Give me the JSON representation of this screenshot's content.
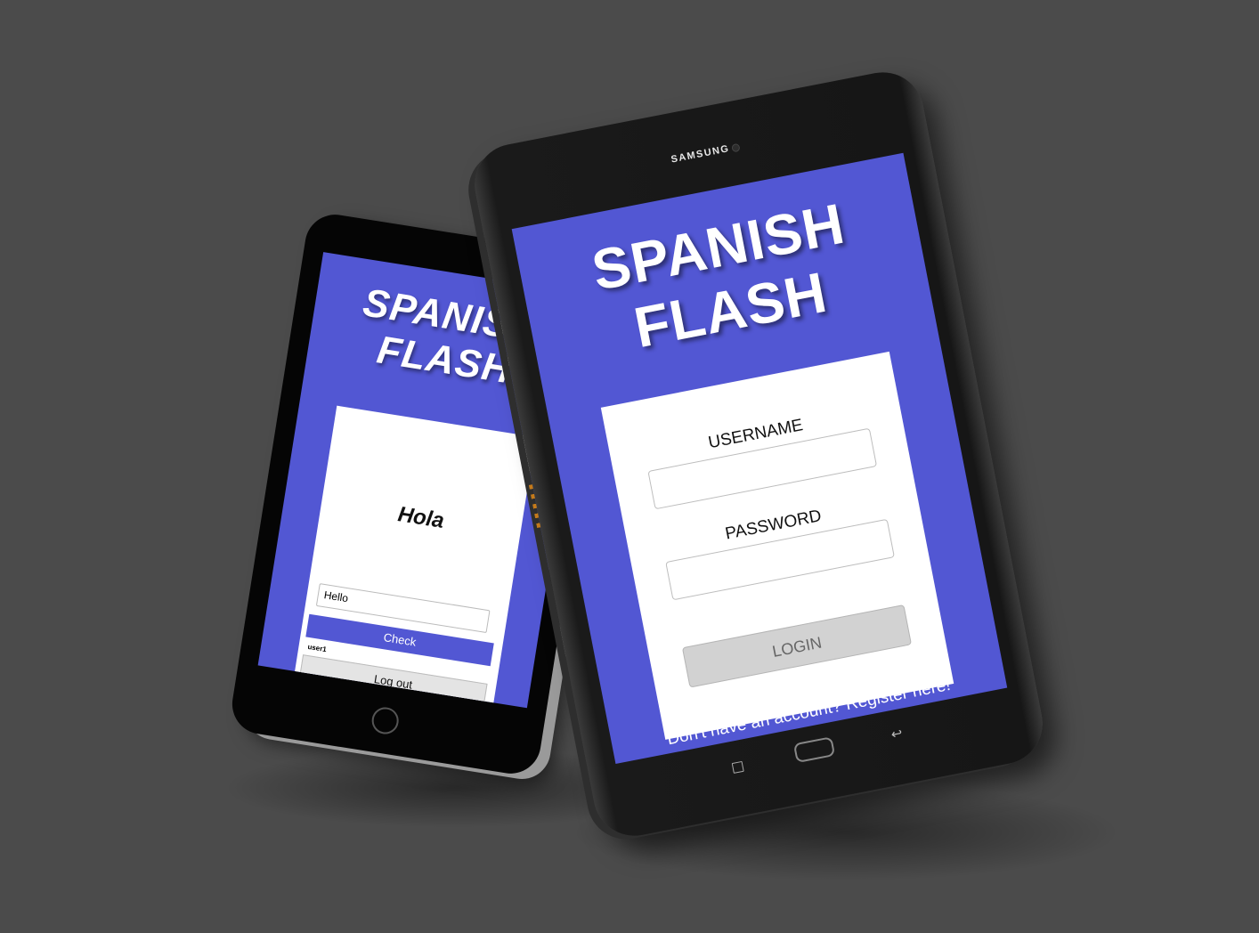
{
  "back_tablet": {
    "app_title_line1": "SPANISH",
    "app_title_line2": "FLASH",
    "flashcard_word": "Hola",
    "answer_input_value": "Hello",
    "check_button": "Check",
    "username": "user1",
    "logout_button": "Log out"
  },
  "front_tablet": {
    "brand": "SAMSUNG",
    "app_title_line1": "SPANISH",
    "app_title_line2": "FLASH",
    "username_label": "USERNAME",
    "password_label": "PASSWORD",
    "login_button": "LOGIN",
    "register_link": "Don't have an account? Register here!",
    "nav_back_glyph": "↩"
  },
  "colors": {
    "background": "#4b4b4b",
    "app_accent": "#5257d3",
    "login_button": "#d2d2d2"
  },
  "icons": [
    "home-button-icon",
    "recent-apps-icon",
    "back-icon",
    "camera-icon"
  ]
}
